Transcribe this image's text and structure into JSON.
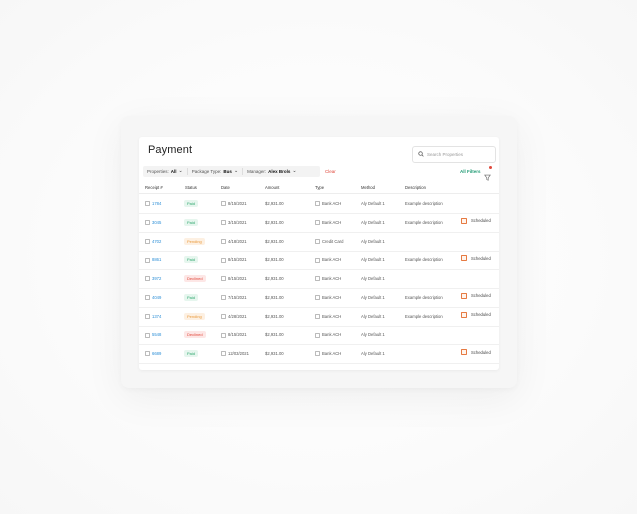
{
  "page": {
    "title": "Payment"
  },
  "search": {
    "placeholder": "Search Properties"
  },
  "filters": [
    {
      "label": "Properties:",
      "value": "All"
    },
    {
      "label": "Package Type:",
      "value": "Bus"
    },
    {
      "label": "Manager:",
      "value": "Alex Brols"
    }
  ],
  "clear_label": "Clear",
  "all_filters_label": "All Filters",
  "colors": {
    "paid": "#2ea66d",
    "pending": "#e99a3c",
    "declined": "#e0483b",
    "link": "#2b8ed6",
    "filters": "#1e9a73"
  },
  "table": {
    "headers": [
      "Receipt #",
      "Status",
      "Date",
      "Amount",
      "Type",
      "Method",
      "Description"
    ],
    "rows": [
      {
        "receipt": "1784",
        "status": "Paid",
        "date": "8/15/2021",
        "amount": "$2,931.00",
        "type": "Bank ACH",
        "method": "Aly Default 1",
        "description": "Example description",
        "schedule": ""
      },
      {
        "receipt": "3045",
        "status": "Paid",
        "date": "3/15/2021",
        "amount": "$2,931.00",
        "type": "Bank ACH",
        "method": "Aly Default 1",
        "description": "Example description",
        "schedule": "Scheduled"
      },
      {
        "receipt": "4702",
        "status": "Pending",
        "date": "4/18/2021",
        "amount": "$2,931.00",
        "type": "Credit Card",
        "method": "Aly Default 1",
        "description": "",
        "schedule": ""
      },
      {
        "receipt": "8861",
        "status": "Paid",
        "date": "8/15/2021",
        "amount": "$2,931.00",
        "type": "Bank ACH",
        "method": "Aly Default 1",
        "description": "Example description",
        "schedule": "Scheduled"
      },
      {
        "receipt": "3972",
        "status": "Declined",
        "date": "8/15/2021",
        "amount": "$2,931.00",
        "type": "Bank ACH",
        "method": "Aly Default 1",
        "description": "",
        "schedule": ""
      },
      {
        "receipt": "4049",
        "status": "Paid",
        "date": "7/15/2021",
        "amount": "$2,931.00",
        "type": "Bank ACH",
        "method": "Aly Default 1",
        "description": "Example description",
        "schedule": "Scheduled"
      },
      {
        "receipt": "1374",
        "status": "Pending",
        "date": "4/28/2021",
        "amount": "$2,931.00",
        "type": "Bank ACH",
        "method": "Aly Default 1",
        "description": "Example description",
        "schedule": "Scheduled"
      },
      {
        "receipt": "5548",
        "status": "Declined",
        "date": "8/15/2021",
        "amount": "$2,931.00",
        "type": "Bank ACH",
        "method": "Aly Default 1",
        "description": "",
        "schedule": ""
      },
      {
        "receipt": "6689",
        "status": "Paid",
        "date": "12/03/2021",
        "amount": "$2,931.00",
        "type": "Bank ACH",
        "method": "Aly Default 1",
        "description": "",
        "schedule": "Scheduled"
      }
    ]
  }
}
